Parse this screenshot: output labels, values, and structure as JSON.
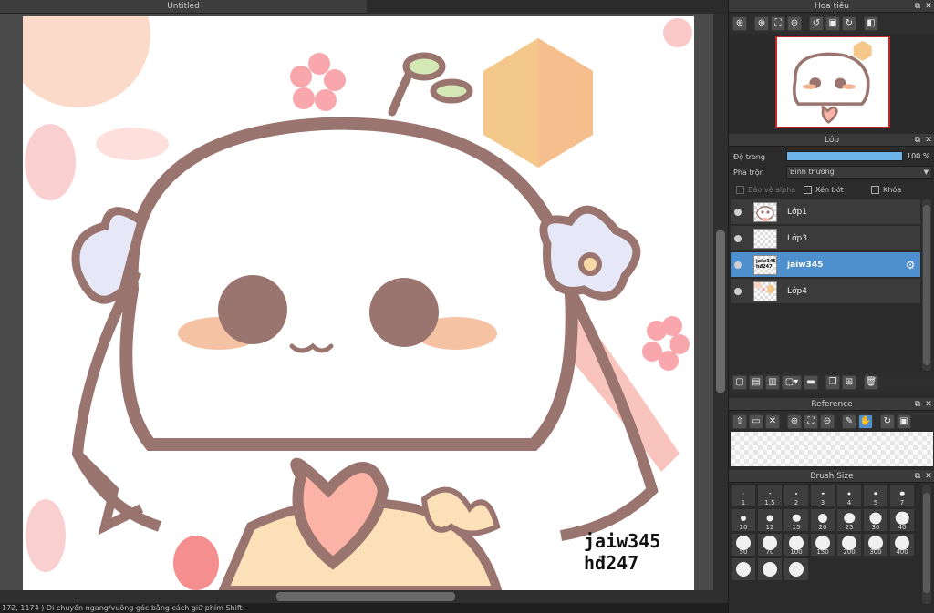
{
  "document": {
    "tab_title": "Untitled"
  },
  "statusbar": {
    "text": "172, 1174 )   Di chuyển ngang/vuông góc bằng cách giữ phím Shift"
  },
  "canvas": {
    "watermark_line1": "jaiw345",
    "watermark_line2": "hđ247"
  },
  "navigator": {
    "title": "Hoa tiêu",
    "buttons": [
      "zoom-in-icon",
      "zoom-in-icon",
      "fit-icon",
      "zoom-out-icon",
      "rotate-left-icon",
      "fit-screen-icon",
      "rotate-right-icon",
      "flip-icon"
    ]
  },
  "layer_panel": {
    "title": "Lớp",
    "opacity_label": "Độ trong",
    "opacity_value": "100 %",
    "opacity_fraction": 1.0,
    "blend_label": "Pha trộn",
    "blend_value": "Bình thường",
    "protect_alpha": "Bảo vệ alpha",
    "clipping": "Xén bớt",
    "lock": "Khóa",
    "layers": [
      {
        "name": "Lớp1",
        "selected": false
      },
      {
        "name": "Lớp3",
        "selected": false
      },
      {
        "name": "jaiw345",
        "selected": true,
        "thumb_line1": "jaiw345",
        "thumb_line2": "hđ247"
      },
      {
        "name": "Lớp4",
        "selected": false
      }
    ]
  },
  "reference": {
    "title": "Reference"
  },
  "brush_size": {
    "title": "Brush Size",
    "sizes": [
      "1",
      "1.5",
      "2",
      "3",
      "4",
      "5",
      "7",
      "10",
      "12",
      "15",
      "20",
      "25",
      "30",
      "40",
      "50",
      "70",
      "100",
      "150",
      "200",
      "300",
      "400",
      "",
      "",
      ""
    ]
  },
  "colors": {
    "accent": "#4e90ce",
    "panel": "#2b2b2b",
    "header": "#3a3a3a",
    "opacity_bar": "#6cb4ea",
    "nav_border": "#c12a2a"
  }
}
